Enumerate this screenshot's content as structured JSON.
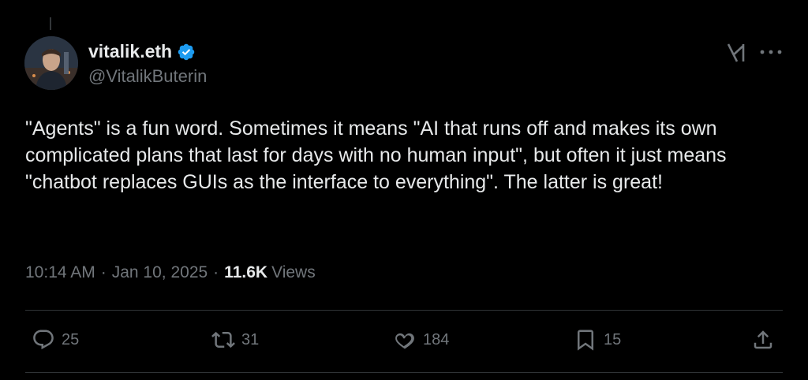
{
  "author": {
    "display_name": "vitalik.eth",
    "handle": "@VitalikButerin",
    "verified": true
  },
  "tweet": {
    "text": "\"Agents\" is a fun word. Sometimes it means \"AI that runs off and makes its own complicated plans that last for days with no human input\", but often it just means \"chatbot replaces GUIs as the interface to everything\". The latter is great!",
    "time": "10:14 AM",
    "date": "Jan 10, 2025",
    "views_count": "11.6K",
    "views_label": "Views",
    "separator": "·"
  },
  "actions": {
    "replies": "25",
    "reposts": "31",
    "likes": "184",
    "bookmarks": "15"
  },
  "colors": {
    "background": "#000000",
    "text": "#e7e9ea",
    "muted": "#71767b",
    "verified": "#1d9bf0",
    "divider": "#2f3336"
  },
  "icons": [
    "grok-icon",
    "more-icon",
    "reply-icon",
    "repost-icon",
    "like-icon",
    "bookmark-icon",
    "share-icon"
  ]
}
